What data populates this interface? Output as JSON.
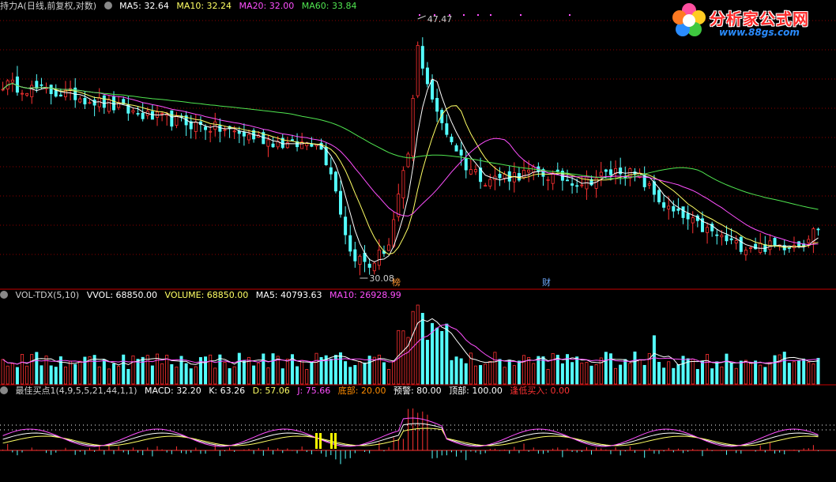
{
  "title": {
    "stock": "持力A(日线,前复权,对数)",
    "ma5": "MA5: 32.64",
    "ma10": "MA10: 32.24",
    "ma20": "MA20: 32.00",
    "ma60": "MA60: 33.84"
  },
  "vol_header": {
    "name": "VOL-TDX(5,10)",
    "vvol": "VVOL: 68850.00",
    "volume": "VOLUME: 68850.00",
    "ma5": "MA5: 40793.63",
    "ma10": "MA10: 26928.99"
  },
  "ind_header": {
    "name": "最佳买点1(4,9,5,5,21,44,1,1)",
    "macd": "MACD: 32.20",
    "k": "K: 63.26",
    "d": "D: 57.06",
    "j": "J: 75.66",
    "bottom": "底部: 20.00",
    "warn": "预警: 80.00",
    "top": "顶部: 100.00",
    "buy": "逢低买入: 0.00"
  },
  "annotations": {
    "high": "47.47",
    "low": "30.08",
    "tag1": "榜",
    "tag2": "财"
  },
  "logo": {
    "name": "分析家公式网",
    "url": "www.88gs.com"
  },
  "colors": {
    "up": "#ff3232",
    "down": "#54ffff",
    "ma5": "#ffffff",
    "ma10": "#ffff64",
    "ma20": "#ff50ff",
    "ma60": "#50e650",
    "grid": "#8c0000",
    "separator": "#c80000"
  },
  "chart_data": {
    "type": "candlestick",
    "panes": [
      "price",
      "volume",
      "indicator"
    ],
    "price_range": [
      30.08,
      47.47
    ],
    "ma_last": {
      "MA5": 32.64,
      "MA10": 32.24,
      "MA20": 32.0,
      "MA60": 33.84
    },
    "last_volume": 68850.0,
    "volume_ma_last": {
      "MA5": 40793.63,
      "MA10": 26928.99
    },
    "indicator_last": {
      "MACD": 32.2,
      "K": 63.26,
      "D": 57.06,
      "J": 75.66
    },
    "levels": {
      "bottom": 20.0,
      "warn": 80.0,
      "top": 100.0
    }
  }
}
